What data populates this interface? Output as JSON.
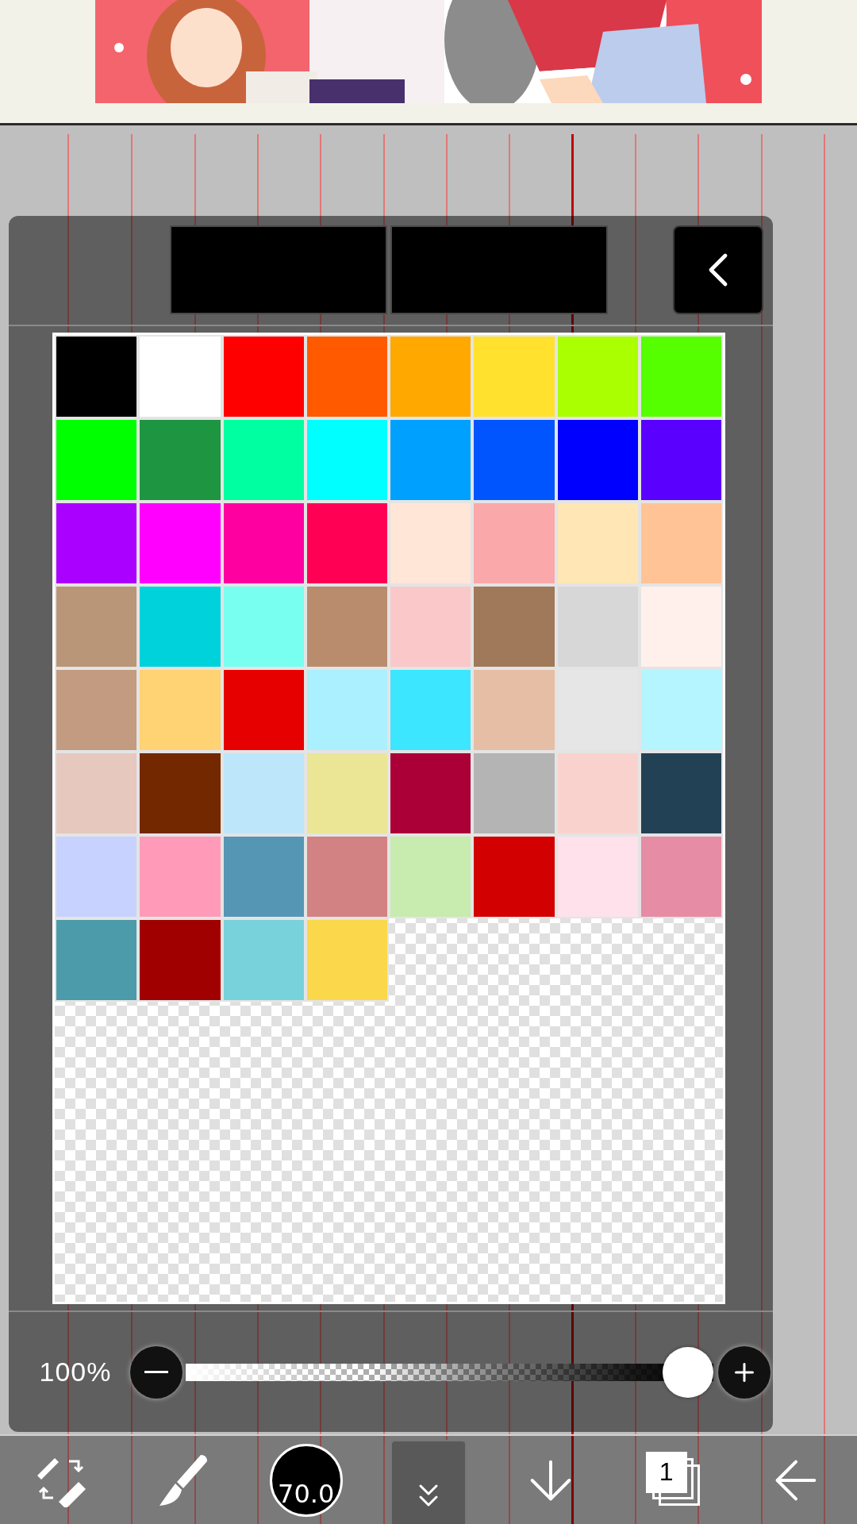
{
  "palette": {
    "swatches": [
      {
        "color": "#000000"
      },
      {
        "color": "#ffffff"
      },
      {
        "color": "#ff0000"
      },
      {
        "color": "#ff5a00"
      },
      {
        "color": "#ffa800"
      },
      {
        "color": "#ffe12e"
      },
      {
        "color": "#aaff00"
      },
      {
        "color": "#55ff00"
      },
      {
        "color": "#00ff00"
      },
      {
        "color": "#1e9641"
      },
      {
        "color": "#00ffa0"
      },
      {
        "color": "#00ffff"
      },
      {
        "color": "#00a0ff"
      },
      {
        "color": "#0055ff"
      },
      {
        "color": "#0000ff"
      },
      {
        "color": "#5a00ff"
      },
      {
        "color": "#aa00ff"
      },
      {
        "color": "#ff00ff"
      },
      {
        "color": "#ff00a0"
      },
      {
        "color": "#ff0055"
      },
      {
        "color": "#ffe6d7"
      },
      {
        "color": "#faa8aa"
      },
      {
        "color": "#ffe6b4"
      },
      {
        "color": "#ffc396"
      },
      {
        "color": "#b99678"
      },
      {
        "color": "#00d2dc"
      },
      {
        "color": "#78fff0"
      },
      {
        "color": "#b98c6e"
      },
      {
        "color": "#fac8c8"
      },
      {
        "color": "#a0785a"
      },
      {
        "color": "#d7d7d7"
      },
      {
        "color": "#fff0eb"
      },
      {
        "color": "#c39b80"
      },
      {
        "color": "#ffd273"
      },
      {
        "color": "#e60000"
      },
      {
        "color": "#aaf0ff"
      },
      {
        "color": "#3ce6ff"
      },
      {
        "color": "#e6bea5"
      },
      {
        "color": "#e6e6e6"
      },
      {
        "color": "#b4f5ff"
      },
      {
        "color": "#e6c8be"
      },
      {
        "color": "#732800"
      },
      {
        "color": "#bee6fa"
      },
      {
        "color": "#ebe696"
      },
      {
        "color": "#aa0037"
      },
      {
        "color": "#b4b4b4"
      },
      {
        "color": "#fad2cd"
      },
      {
        "color": "#234155"
      },
      {
        "color": "#c8d2ff"
      },
      {
        "color": "#ff9bb9"
      },
      {
        "color": "#5596b4"
      },
      {
        "color": "#d28282"
      },
      {
        "color": "#c8ebaf"
      },
      {
        "color": "#d20000"
      },
      {
        "color": "#ffe1eb"
      },
      {
        "color": "#e68ca5"
      },
      {
        "color": "#4b9baa"
      },
      {
        "color": "#a00000"
      },
      {
        "color": "#78d2dc"
      },
      {
        "color": "#fad74b"
      }
    ]
  },
  "opacity_slider": {
    "reading": "100%",
    "level": 1.0
  },
  "toolbar": {
    "brush_size": "70.0",
    "layer_count": "1"
  }
}
